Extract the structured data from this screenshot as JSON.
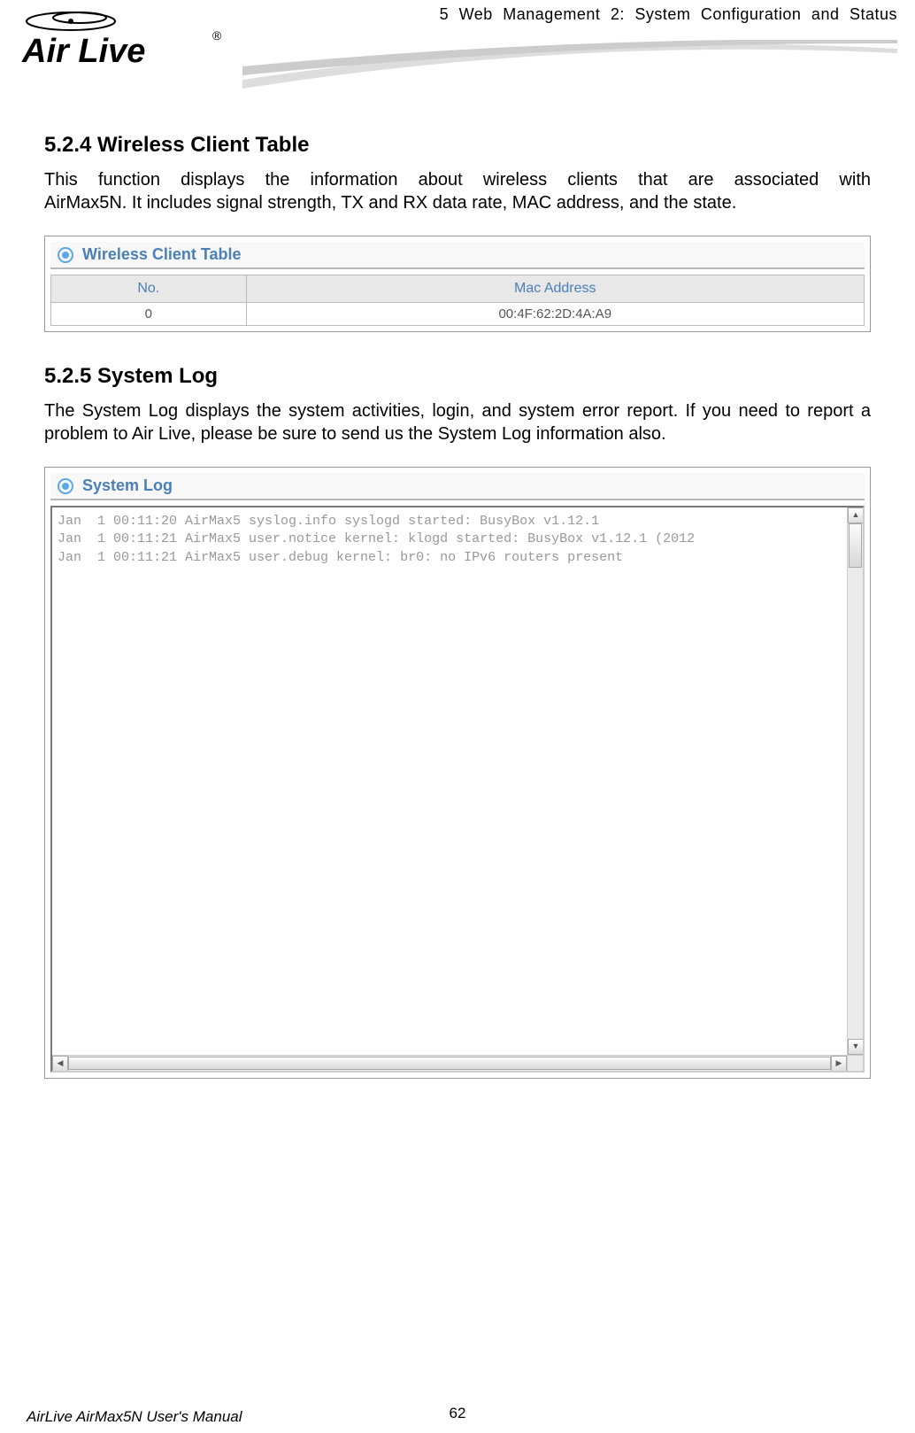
{
  "header": {
    "chapter_line": "5  Web  Management  2:  System  Configuration  and  Status",
    "logo_text_main": "Air Live",
    "logo_rm": "®"
  },
  "section1": {
    "heading": "5.2.4 Wireless Client Table",
    "text_line1": "This  function  displays  the  information  about  wireless  clients  that  are  associated  with",
    "text_line2": "AirMax5N. It includes signal strength, TX and RX data rate, MAC address, and the state.",
    "panel_title": "Wireless Client Table",
    "table": {
      "col_no": "No.",
      "col_mac": "Mac Address",
      "rows": [
        {
          "no": "0",
          "mac": "00:4F:62:2D:4A:A9"
        }
      ]
    }
  },
  "section2": {
    "heading": "5.2.5 System Log",
    "text_line1": "The System Log displays the system activities, login, and system error report. If you need",
    "text_line2": "to report a problem to Air Live, please be sure to send us the System Log information also.",
    "panel_title": "System Log",
    "log_lines": [
      "Jan  1 00:11:20 AirMax5 syslog.info syslogd started: BusyBox v1.12.1",
      "Jan  1 00:11:21 AirMax5 user.notice kernel: klogd started: BusyBox v1.12.1 (2012",
      "Jan  1 00:11:21 AirMax5 user.debug kernel: br0: no IPv6 routers present"
    ]
  },
  "footer": {
    "page_num": "62",
    "manual_title": "AirLive AirMax5N User's Manual"
  },
  "arrows": {
    "up": "▲",
    "down": "▼",
    "left": "◀",
    "right": "▶"
  }
}
